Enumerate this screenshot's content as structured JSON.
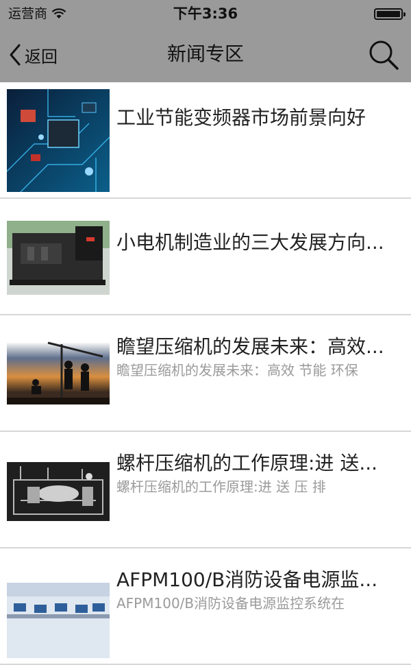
{
  "status_bar": {
    "carrier": "运营商",
    "time": "下午3:36"
  },
  "nav": {
    "back_label": "返回",
    "title": "新闻专区"
  },
  "news": [
    {
      "title": "工业节能变频器市场前景向好",
      "summary": ""
    },
    {
      "title": "小电机制造业的三大发展方向...",
      "summary": ""
    },
    {
      "title": "瞻望压缩机的发展未来：高效...",
      "summary": "瞻望压缩机的发展未来：高效 节能 环保"
    },
    {
      "title": "螺杆压缩机的工作原理:进 送...",
      "summary": "螺杆压缩机的工作原理:进 送 压 排"
    },
    {
      "title": "AFPM100/B消防设备电源监...",
      "summary": "AFPM100/B消防设备电源监控系统在"
    }
  ]
}
